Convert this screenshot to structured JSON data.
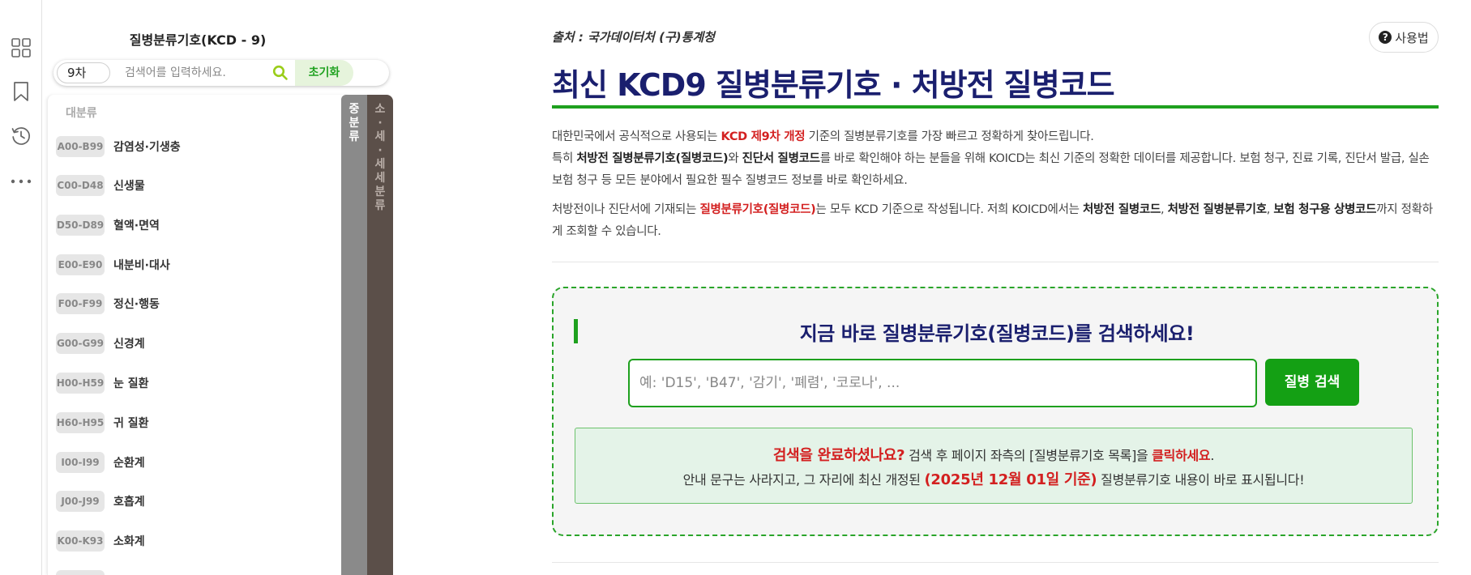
{
  "rail": {
    "icons": [
      "grid-icon",
      "bookmark-icon",
      "history-icon",
      "more-icon"
    ]
  },
  "panel": {
    "title": "질병분류기호(KCD - 9)",
    "version": "9차",
    "search_placeholder": "검색어를 입력하세요.",
    "reset_label": "초기화",
    "list_header": "대분류",
    "mid_label": "중분류",
    "small_label": "소·세·세세분류",
    "categories": [
      {
        "code": "A00-B99",
        "label": "감염성·기생충"
      },
      {
        "code": "C00-D48",
        "label": "신생물"
      },
      {
        "code": "D50-D89",
        "label": "혈액·면역"
      },
      {
        "code": "E00-E90",
        "label": "내분비·대사"
      },
      {
        "code": "F00-F99",
        "label": "정신·행동"
      },
      {
        "code": "G00-G99",
        "label": "신경계"
      },
      {
        "code": "H00-H59",
        "label": "눈 질환"
      },
      {
        "code": "H60-H95",
        "label": "귀 질환"
      },
      {
        "code": "I00-I99",
        "label": "순환계"
      },
      {
        "code": "J00-J99",
        "label": "호흡계"
      },
      {
        "code": "K00-K93",
        "label": "소화계"
      }
    ]
  },
  "main": {
    "source": "출처 : 국가데이터처 (구)통계청",
    "help_label": "사용법",
    "title": "최신 KCD9 질병분류기호 · 처방전 질병코드",
    "intro": {
      "p1_a": "대한민국에서 공식적으로 사용되는 ",
      "p1_b": "KCD 제9차 개정",
      "p1_c": " 기준의 질병분류기호를 가장 빠르고 정확하게 찾아드립니다.",
      "p2_a": "특히 ",
      "p2_b": "처방전 질병분류기호(질병코드)",
      "p2_c": "와 ",
      "p2_d": "진단서 질병코드",
      "p2_e": "를 바로 확인해야 하는 분들을 위해 KOICD는 최신 기준의 정확한 데이터를 제공합니다. 보험 청구, 진료 기록, 진단서 발급, 실손보험 청구 등 모든 분야에서 필요한 필수 질병코드 정보를 바로 확인하세요.",
      "p3_a": "처방전이나 진단서에 기재되는 ",
      "p3_b": "질병분류기호(질병코드)",
      "p3_c": "는 모두 KCD 기준으로 작성됩니다. 저희 KOICD에서는 ",
      "p3_d": "처방전 질병코드",
      "p3_e": ", ",
      "p3_f": "처방전 질병분류기호",
      "p3_g": ", ",
      "p3_h": "보험 청구용 상병코드",
      "p3_i": "까지 정확하게 조회할 수 있습니다."
    },
    "search_card": {
      "title": "지금 바로 질병분류기호(질병코드)를 검색하세요!",
      "placeholder": "예: 'D15', 'B47', '감기', '폐렴', '코로나', ...",
      "button_label": "질병 검색",
      "notice_l1_a": "검색을 완료하셨나요?",
      "notice_l1_b": " 검색 후 페이지 좌측의 [질병분류기호 목록]을 ",
      "notice_l1_c": "클릭하세요",
      "notice_l1_d": ".",
      "notice_l2_a": "안내 문구는 사라지고, 그 자리에 최신 개정된 ",
      "notice_l2_b": "(2025년 12월 01일 기준)",
      "notice_l2_c": " 질병분류기호 내용이 바로 표시됩니다!"
    }
  },
  "colors": {
    "accent_green": "#1ea01e",
    "title_navy": "#1a1f6e",
    "highlight_red": "#d32020"
  }
}
